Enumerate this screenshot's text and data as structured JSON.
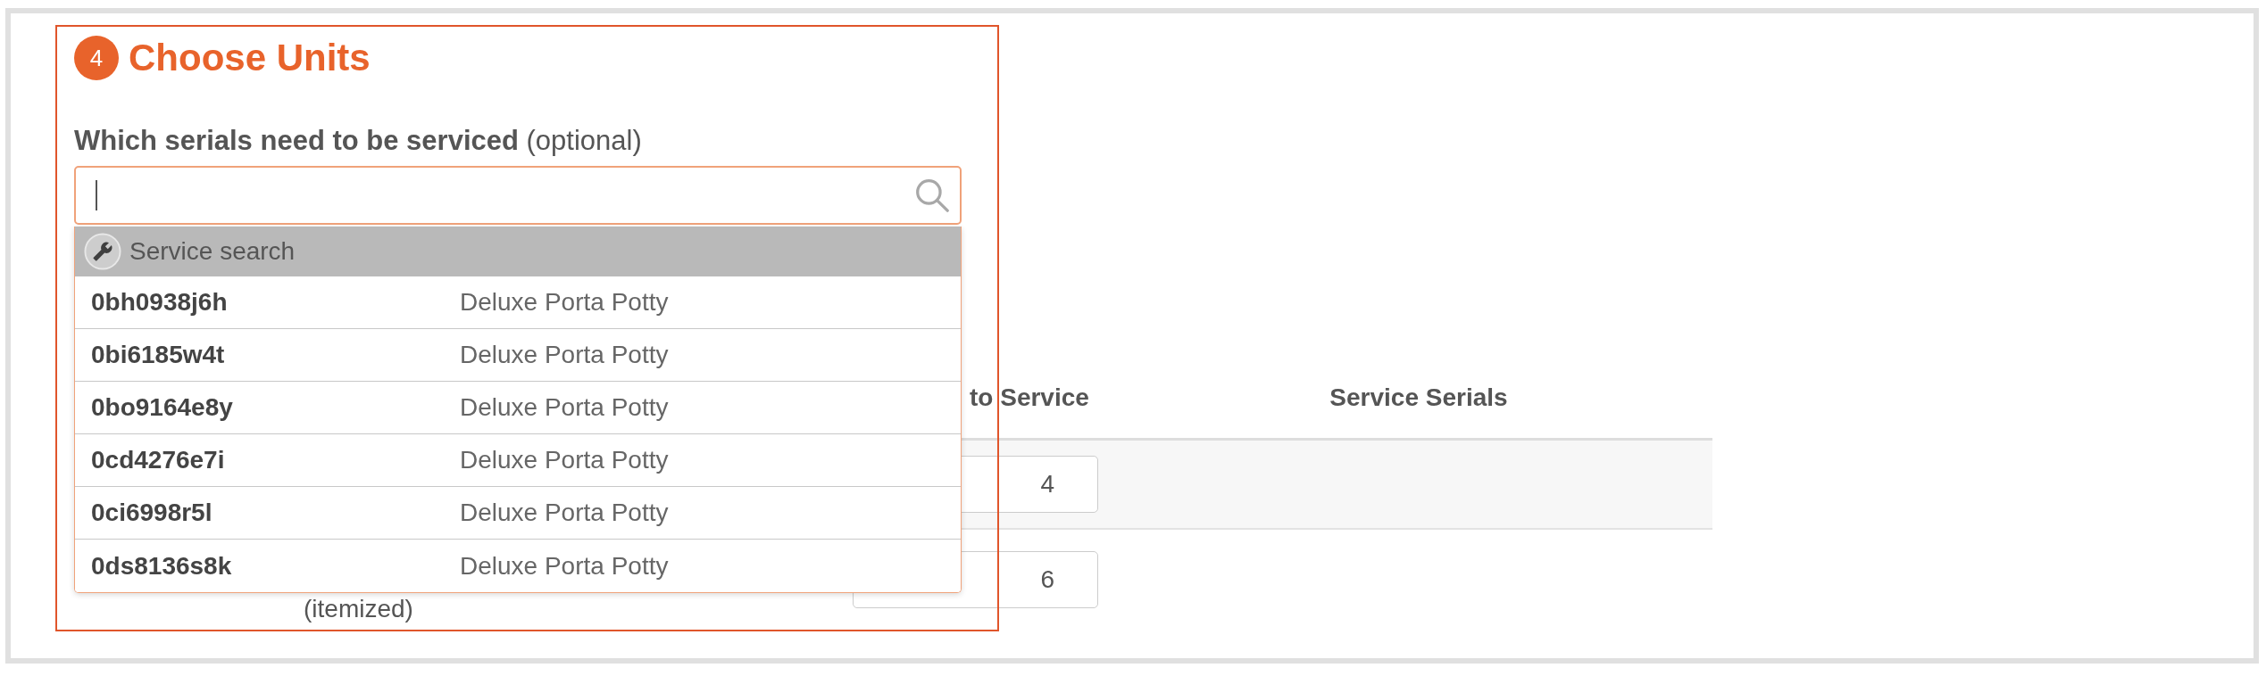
{
  "section": {
    "step": "4",
    "title": "Choose Units"
  },
  "serials_field": {
    "label": "**Which serials need to be serviced** (optional)",
    "focused": true
  },
  "dropdown": {
    "header": "Service search",
    "options": [
      {
        "serial": "0bh0938j6h",
        "description": "Deluxe Porta Potty"
      },
      {
        "serial": "0bi6185w4t",
        "description": "Deluxe Porta Potty"
      },
      {
        "serial": "0bo9164e8y",
        "description": "Deluxe Porta Potty"
      },
      {
        "serial": "0cd4276e7i",
        "description": "Deluxe Porta Potty"
      },
      {
        "serial": "0ci6998r5l",
        "description": "Deluxe Porta Potty"
      },
      {
        "serial": "0ds8136s8k",
        "description": "Deluxe Porta Potty"
      }
    ]
  },
  "table": {
    "header": {
      "column_2": "to Service",
      "column_3": "Service Serials"
    },
    "rows": [
      {
        "column_2": "4"
      },
      {
        "column_1": "(itemized)",
        "column_2": "6"
      }
    ]
  }
}
